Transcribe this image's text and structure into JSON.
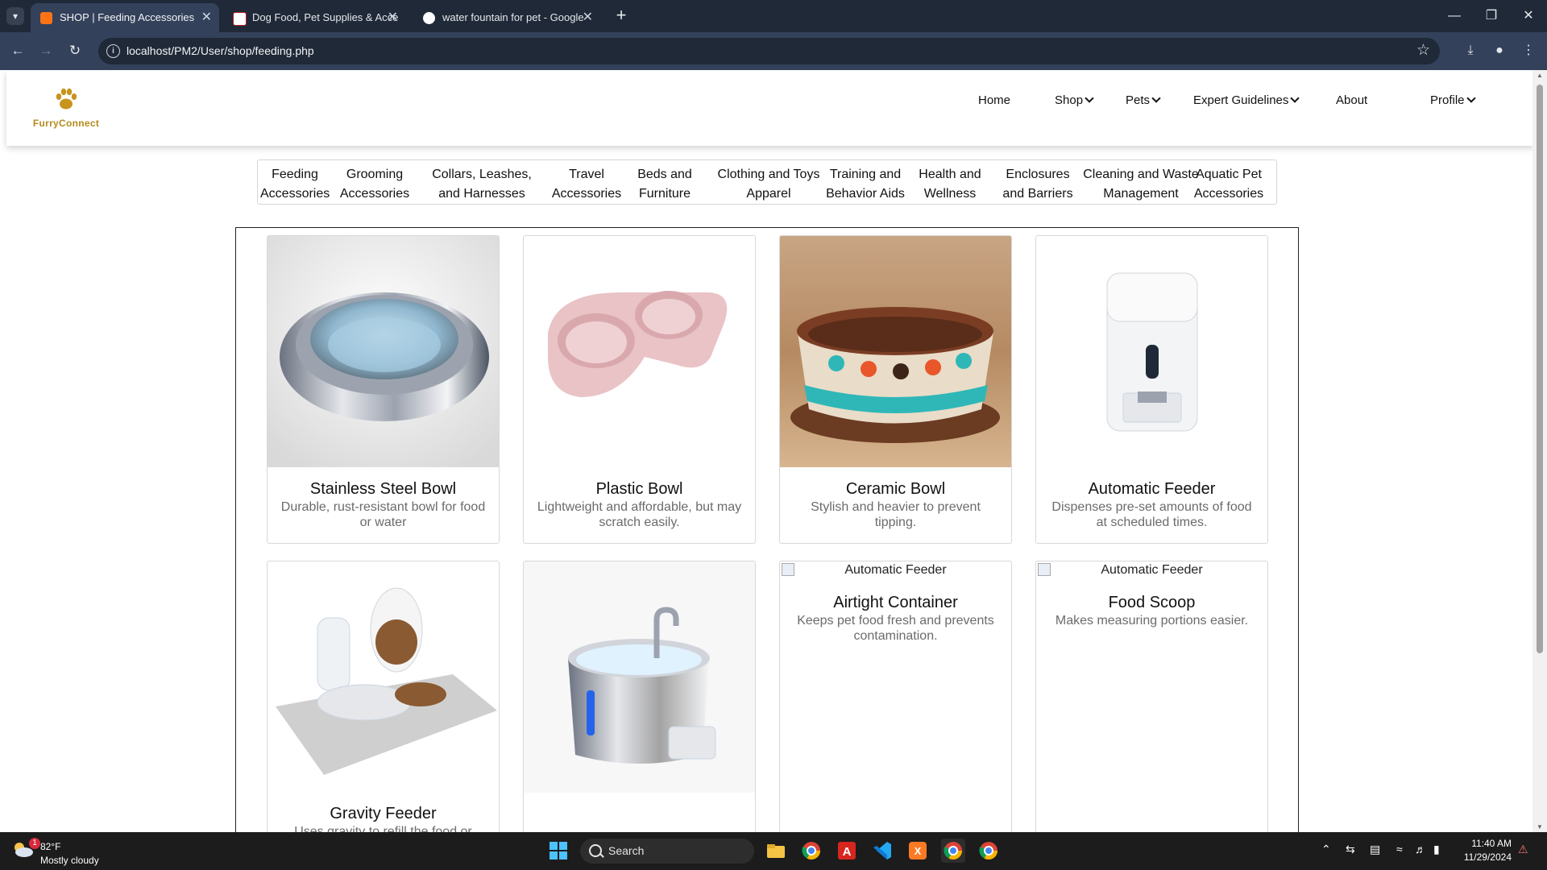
{
  "browser": {
    "tabs": [
      {
        "title": "SHOP | Feeding Accessories",
        "active": true
      },
      {
        "title": "Dog Food, Pet Supplies & Acce",
        "active": false
      },
      {
        "title": "water fountain for pet - Google",
        "active": false
      }
    ],
    "url": "localhost/PM2/User/shop/feeding.php"
  },
  "site": {
    "brand": "FurryConnect",
    "nav": [
      {
        "label": "Home",
        "dropdown": false
      },
      {
        "label": "Shop",
        "dropdown": true
      },
      {
        "label": "Pets",
        "dropdown": true
      },
      {
        "label": "Expert Guidelines",
        "dropdown": true
      },
      {
        "label": "About",
        "dropdown": false
      },
      {
        "label": "Profile",
        "dropdown": true
      }
    ],
    "categories": [
      {
        "line1": "Feeding",
        "line2": "Accessories"
      },
      {
        "line1": "Grooming",
        "line2": "Accessories"
      },
      {
        "line1": "Collars, Leashes,",
        "line2": "and Harnesses"
      },
      {
        "line1": "Travel",
        "line2": "Accessories"
      },
      {
        "line1": "Beds and",
        "line2": "Furniture"
      },
      {
        "line1": "Clothing and Toys",
        "line2": "Apparel"
      },
      {
        "line1": "Training and",
        "line2": "Behavior Aids"
      },
      {
        "line1": "Health and",
        "line2": "Wellness"
      },
      {
        "line1": "Enclosures",
        "line2": "and Barriers"
      },
      {
        "line1": "Cleaning and Waste",
        "line2": "Management"
      },
      {
        "line1": "Aquatic Pet",
        "line2": "Accessories"
      }
    ],
    "products": [
      {
        "title": "Stainless Steel Bowl",
        "desc": "Durable, rust-resistant bowl for food or water",
        "image": "steel-bowl"
      },
      {
        "title": "Plastic Bowl",
        "desc": "Lightweight and affordable, but may scratch easily.",
        "image": "plastic-bowl"
      },
      {
        "title": "Ceramic Bowl",
        "desc": "Stylish and heavier to prevent tipping.",
        "image": "ceramic-bowl"
      },
      {
        "title": "Automatic Feeder",
        "desc": "Dispenses pre-set amounts of food at scheduled times.",
        "image": "auto-feeder"
      },
      {
        "title": "Gravity Feeder",
        "desc": "Uses gravity to refill the food or",
        "image": "gravity-feeder"
      },
      {
        "title": "",
        "desc": "",
        "image": "water-fountain"
      },
      {
        "title": "Airtight Container",
        "desc": "Keeps pet food fresh and prevents contamination.",
        "image": "broken",
        "alt": "Automatic Feeder"
      },
      {
        "title": "Food Scoop",
        "desc": "Makes measuring portions easier.",
        "image": "broken",
        "alt": "Automatic Feeder"
      }
    ]
  },
  "taskbar": {
    "weather_temp": "82°F",
    "weather_cond": "Mostly cloudy",
    "weather_badge": "1",
    "search_label": "Search",
    "time": "11:40 AM",
    "date": "11/29/2024"
  },
  "colors": {
    "brand_gold": "#b58a1b",
    "chrome_dark": "#1f2937",
    "chrome_mid": "#33415b"
  }
}
